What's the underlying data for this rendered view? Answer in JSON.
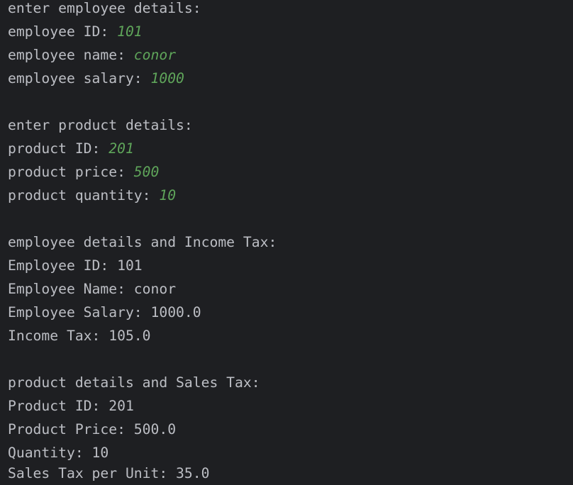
{
  "colors": {
    "background": "#1e1f22",
    "output_text": "#bcbec4",
    "user_input": "#5fa55a"
  },
  "console": {
    "employee_input": {
      "header": "enter employee details:",
      "id_prompt": "employee ID: ",
      "id_value": "101",
      "name_prompt": "employee name: ",
      "name_value": "conor",
      "salary_prompt": "employee salary: ",
      "salary_value": "1000"
    },
    "product_input": {
      "header": "enter product details:",
      "id_prompt": "product ID: ",
      "id_value": "201",
      "price_prompt": "product price: ",
      "price_value": "500",
      "quantity_prompt": "product quantity: ",
      "quantity_value": "10"
    },
    "employee_output": {
      "header": "employee details and Income Tax:",
      "id_line": "Employee ID: 101",
      "name_line": "Employee Name: conor",
      "salary_line": "Employee Salary: 1000.0",
      "tax_line": "Income Tax: 105.0"
    },
    "product_output": {
      "header": "product details and Sales Tax:",
      "id_line": "Product ID: 201",
      "price_line": "Product Price: 500.0",
      "quantity_line": "Quantity: 10",
      "tax_line": "Sales Tax per Unit: 35.0"
    }
  }
}
